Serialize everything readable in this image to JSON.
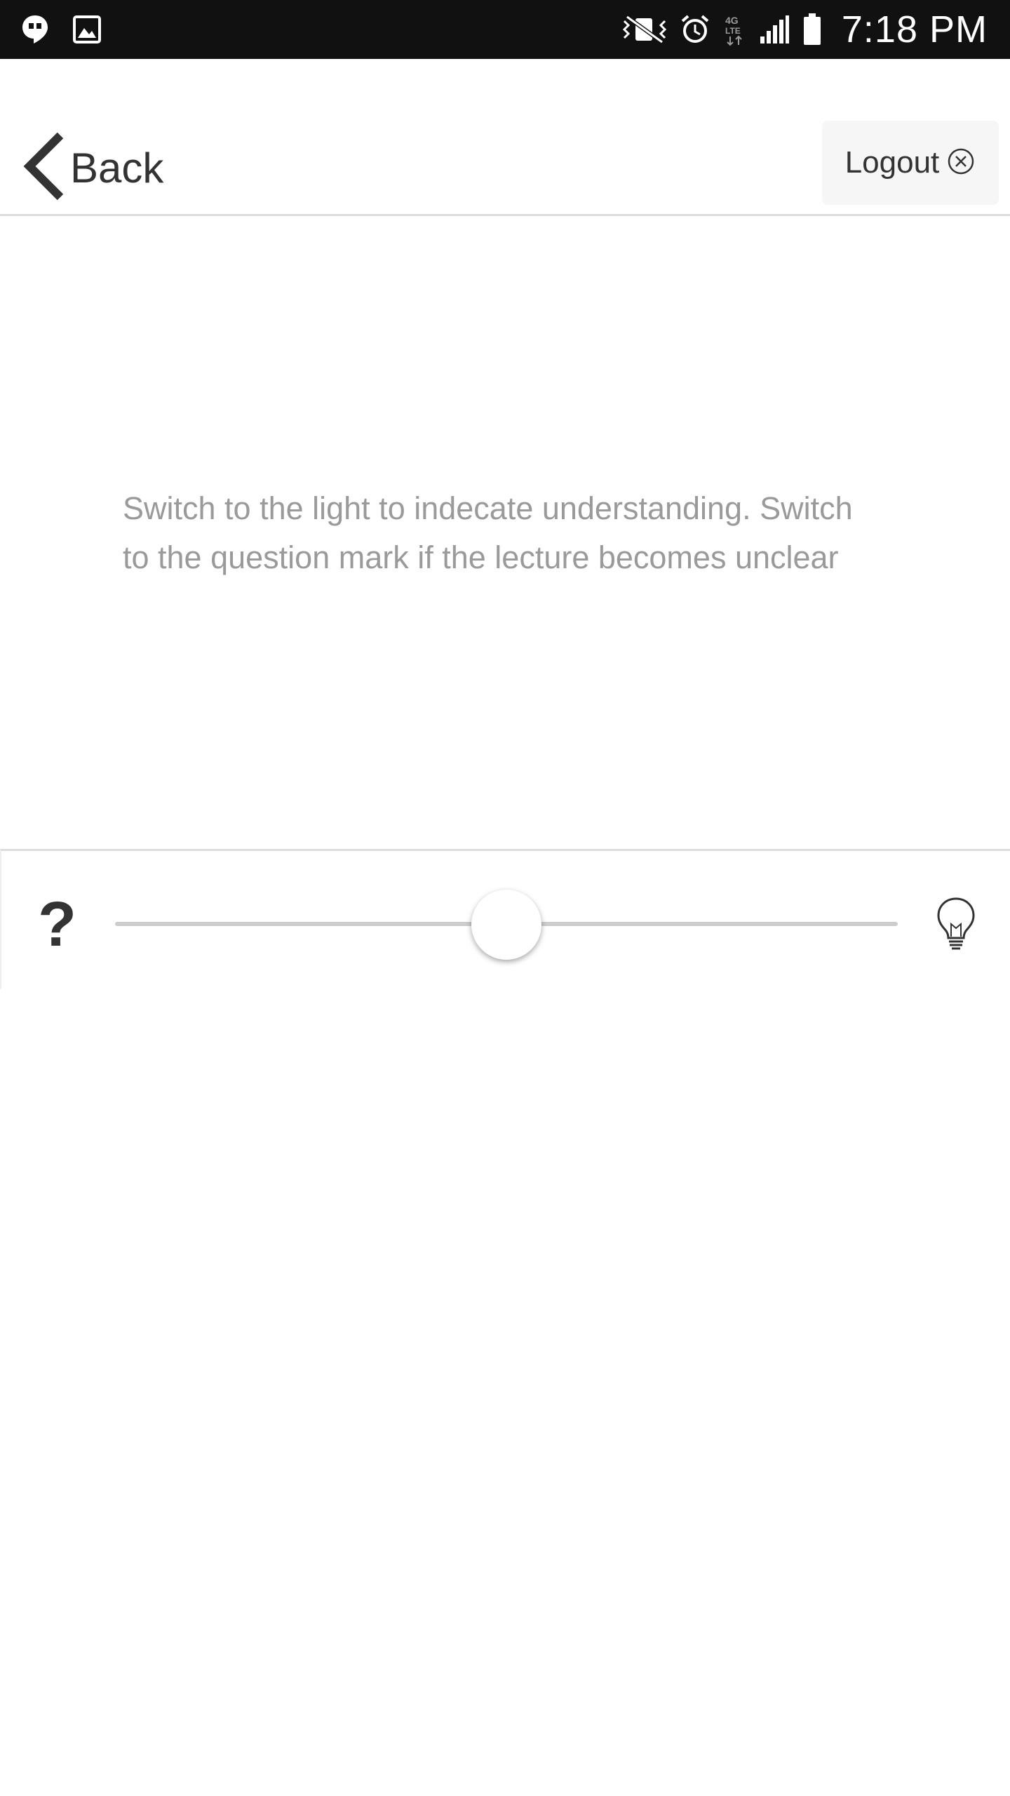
{
  "status_bar": {
    "time": "7:18 PM",
    "left_icons": [
      "hangouts-icon",
      "gallery-icon"
    ],
    "right_icons": [
      "vibrate-mute-icon",
      "alarm-icon",
      "lte-data-icon",
      "signal-icon",
      "battery-icon"
    ]
  },
  "header": {
    "back_label": "Back",
    "logout_label": "Logout"
  },
  "main": {
    "instruction_line1": "Switch to the light to indecate understanding. Switch",
    "instruction_line2": "to the question mark if the lecture becomes unclear"
  },
  "slider": {
    "left_label": "?",
    "right_icon": "lightbulb-icon",
    "value_fraction": 0.5
  },
  "colors": {
    "status_bar_bg": "#111111",
    "text_dark": "#333333",
    "text_muted": "#9a9a9a",
    "divider": "#dddddd",
    "track": "#cccccc"
  }
}
